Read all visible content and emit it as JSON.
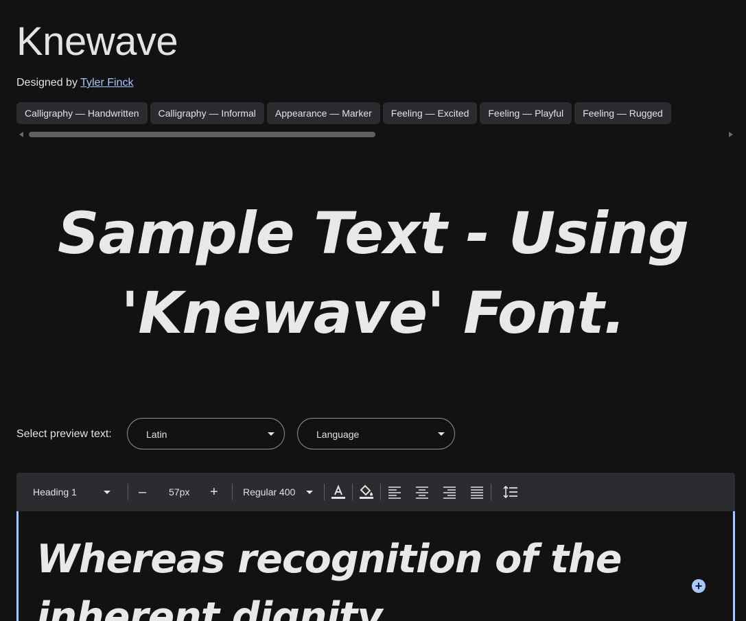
{
  "font": {
    "name": "Knewave",
    "designed_by_prefix": "Designed by",
    "designer": "Tyler Finck"
  },
  "tags": [
    "Calligraphy — Handwritten",
    "Calligraphy — Informal",
    "Appearance — Marker",
    "Feeling — Excited",
    "Feeling — Playful",
    "Feeling — Rugged"
  ],
  "sample_text": "Sample Text - Using 'Knewave' Font.",
  "preview": {
    "label": "Select preview text:",
    "script_value": "Latin",
    "language_value": "Language"
  },
  "toolbar": {
    "style_value": "Heading 1",
    "size_value": "57px",
    "minus_label": "–",
    "plus_label": "+",
    "weight_value": "Regular 400"
  },
  "editor": {
    "text": "Whereas recognition of the inherent dignity"
  },
  "icons": {
    "text_color": "text-color-icon",
    "highlight": "fill-color-icon",
    "align_left": "align-left-icon",
    "align_center": "align-center-icon",
    "align_right": "align-right-icon",
    "align_justify": "align-justify-icon",
    "line_height": "line-height-icon",
    "add": "add-circle-icon"
  },
  "colors": {
    "background": "#121212",
    "chip": "#2b2c2f",
    "accent": "#a8c7fa",
    "text": "#e3e3e3"
  }
}
